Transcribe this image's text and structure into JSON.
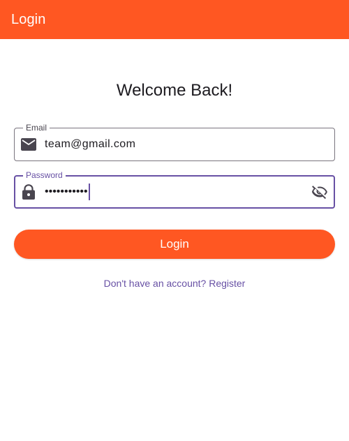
{
  "colors": {
    "accent": "#ff5722",
    "primary": "#6750a4",
    "outline": "#79747e",
    "text": "#1d1b20"
  },
  "app_bar": {
    "title": "Login"
  },
  "form": {
    "heading": "Welcome Back!",
    "email": {
      "label": "Email",
      "value": "team@gmail.com",
      "icon": "email-icon"
    },
    "password": {
      "label": "Password",
      "value": "•••••••••••",
      "icon": "lock-icon",
      "toggle_icon": "visibility-off-icon",
      "focused": true
    },
    "login_button_label": "Login",
    "register_link": "Don't have an account? Register"
  }
}
